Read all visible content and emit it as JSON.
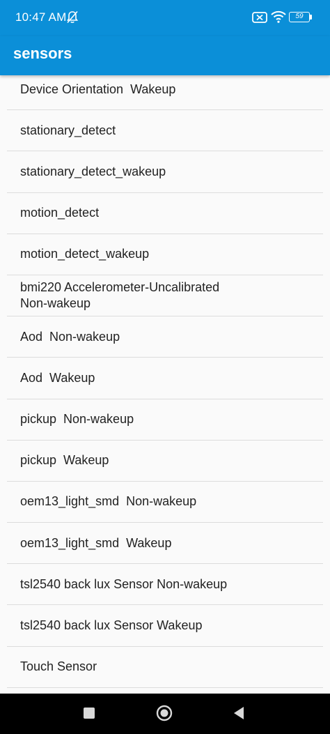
{
  "status_bar": {
    "time": "10:47 AM",
    "battery_level": "59",
    "icons": [
      "bell-off-icon",
      "sim-no-signal-icon",
      "wifi-icon",
      "battery-icon"
    ]
  },
  "app_bar": {
    "title": "sensors"
  },
  "sensors": [
    {
      "label": "Device Orientation  Wakeup"
    },
    {
      "label": "stationary_detect"
    },
    {
      "label": "stationary_detect_wakeup"
    },
    {
      "label": "motion_detect"
    },
    {
      "label": "motion_detect_wakeup"
    },
    {
      "label": "bmi220 Accelerometer-Uncalibrated\nNon-wakeup"
    },
    {
      "label": "Aod  Non-wakeup"
    },
    {
      "label": "Aod  Wakeup"
    },
    {
      "label": "pickup  Non-wakeup"
    },
    {
      "label": "pickup  Wakeup"
    },
    {
      "label": "oem13_light_smd  Non-wakeup"
    },
    {
      "label": "oem13_light_smd  Wakeup"
    },
    {
      "label": "tsl2540 back lux Sensor Non-wakeup"
    },
    {
      "label": "tsl2540 back lux Sensor Wakeup"
    },
    {
      "label": "Touch Sensor"
    }
  ],
  "navigation": {
    "icons": [
      "recents-icon",
      "home-icon",
      "back-icon"
    ]
  },
  "colors": {
    "primary": "#0b8fd8",
    "background": "#fafafa",
    "divider": "#dcdcdc",
    "nav_bar": "#000000"
  }
}
